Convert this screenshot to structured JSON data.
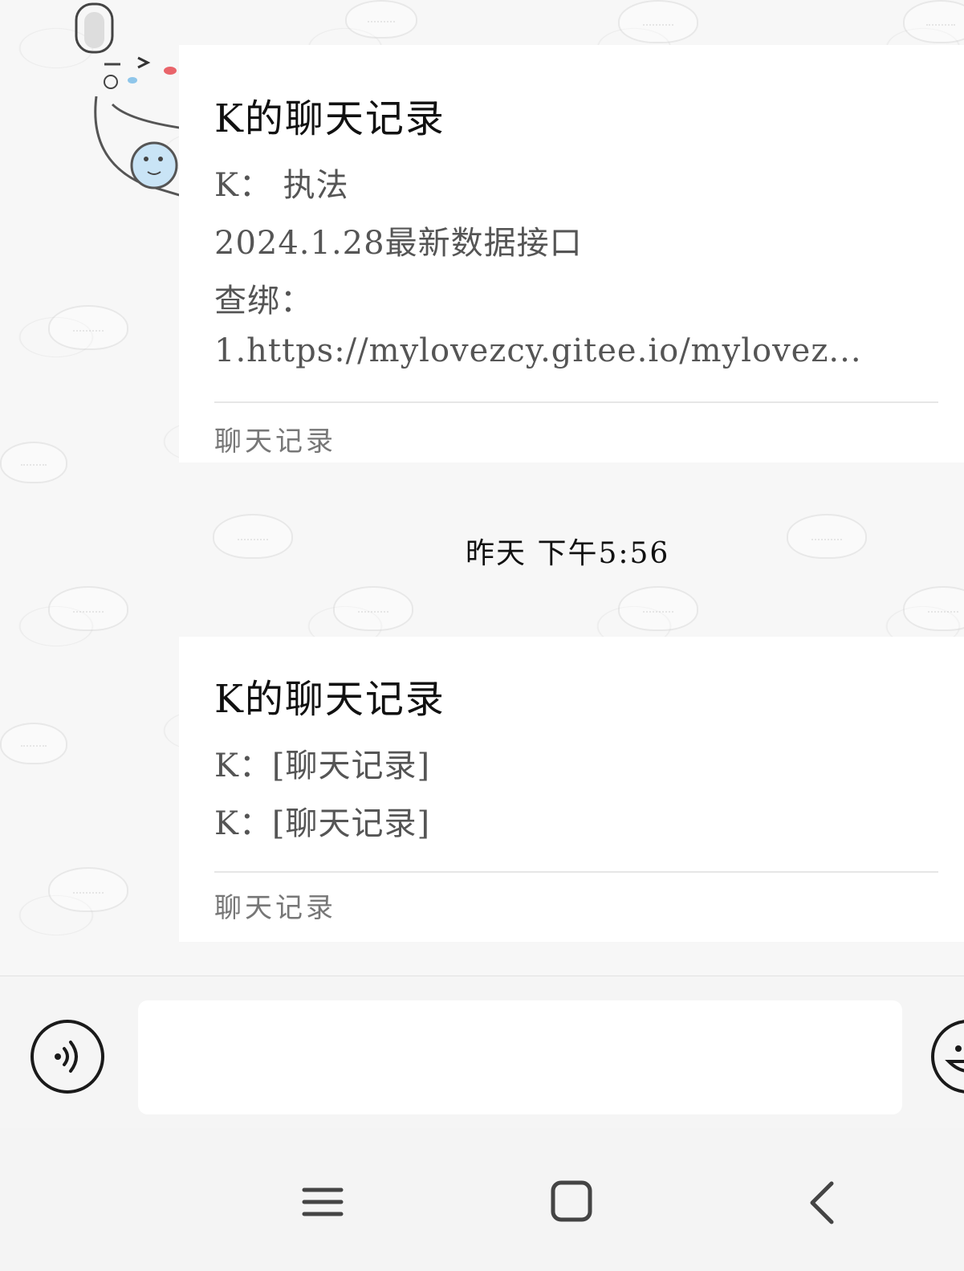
{
  "chat": {
    "messages": [
      {
        "type": "chat-record-card",
        "title": "K的聊天记录",
        "lines": [
          "K： 执法",
          "2024.1.28最新数据接口",
          "查绑：",
          "1.https://mylovezcy.gitee.io/mylovez..."
        ],
        "footer": "聊天记录"
      },
      {
        "type": "timestamp",
        "text": "昨天 下午5:56"
      },
      {
        "type": "chat-record-card",
        "title": "K的聊天记录",
        "lines": [
          "K：[聊天记录]",
          "K：[聊天记录]"
        ],
        "footer": "聊天记录"
      }
    ]
  },
  "input_bar": {
    "voice_icon": "voice-input-icon",
    "message_value": "",
    "emoji_icon": "emoji-icon"
  },
  "nav_bar": {
    "recent_icon": "menu-lines-icon",
    "home_icon": "rounded-square-icon",
    "back_icon": "chevron-left-icon"
  },
  "colors": {
    "card_background": "#ffffff",
    "chat_background": "#f7f7f7",
    "title_text": "#111111",
    "body_text": "#555555"
  }
}
